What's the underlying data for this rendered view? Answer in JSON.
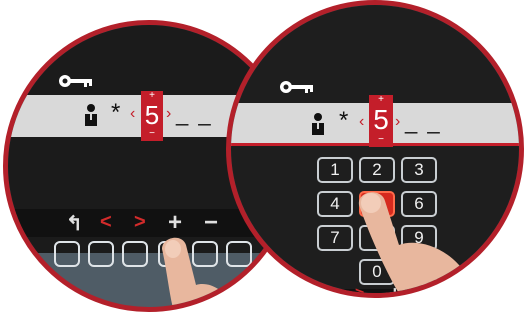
{
  "left_panel": {
    "entry": {
      "asterisk": "*",
      "digit": "5",
      "arrow_left": "‹",
      "arrow_right": "›",
      "plus": "+",
      "minus": "−",
      "blanks": "_ _"
    },
    "softkeys": [
      {
        "name": "back-softkey",
        "label": "↰"
      },
      {
        "name": "left-softkey",
        "label": "<"
      },
      {
        "name": "right-softkey",
        "label": ">"
      },
      {
        "name": "plus-softkey",
        "label": "+"
      },
      {
        "name": "minus-softkey",
        "label": "−"
      }
    ]
  },
  "right_panel": {
    "entry": {
      "asterisk": "*",
      "digit": "5",
      "arrow_left": "‹",
      "arrow_right": "›",
      "plus": "+",
      "minus": "−",
      "blanks": "_ _"
    },
    "keypad": [
      "1",
      "2",
      "3",
      "4",
      "5",
      "6",
      "7",
      "8",
      "9",
      "0"
    ],
    "active_key": "5",
    "softkeys": [
      {
        "name": "left-softkey",
        "label": "<"
      },
      {
        "name": "right-softkey",
        "label": ">"
      },
      {
        "name": "plus-softkey",
        "label": "+"
      }
    ]
  },
  "colors": {
    "accent": "#c41e2a",
    "screen": "#1b1b1b",
    "band": "#d9d9d9",
    "frame": "#b3202a"
  }
}
